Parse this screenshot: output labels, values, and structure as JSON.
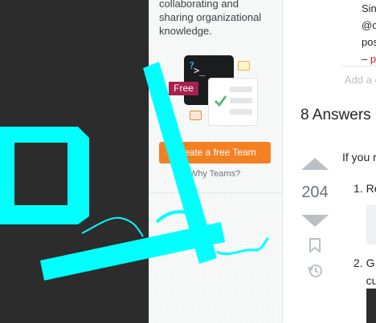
{
  "sidebar": {
    "teams_text": "collaborating and sharing organizational knowledge.",
    "terminal_prompt": ">_",
    "terminal_q": "?",
    "free_badge": "Free",
    "cta_label": "Create a free Team",
    "why_label": "Why Teams?"
  },
  "question": {
    "comment_lines": [
      "Sin",
      "@c",
      "pos"
    ],
    "comment_dash": "–",
    "comment_red": "p",
    "add_comment": "Add a c"
  },
  "answers": {
    "count_label": "8 Answers",
    "vote_count": "204",
    "text": "If you r",
    "list_item_1": "Re",
    "list_item_2_a": "G",
    "list_item_2_b": "cu"
  },
  "colors": {
    "annotation_cyan": "#00ffff",
    "accent_orange": "#f48024",
    "badge_free": "#a6224f"
  }
}
